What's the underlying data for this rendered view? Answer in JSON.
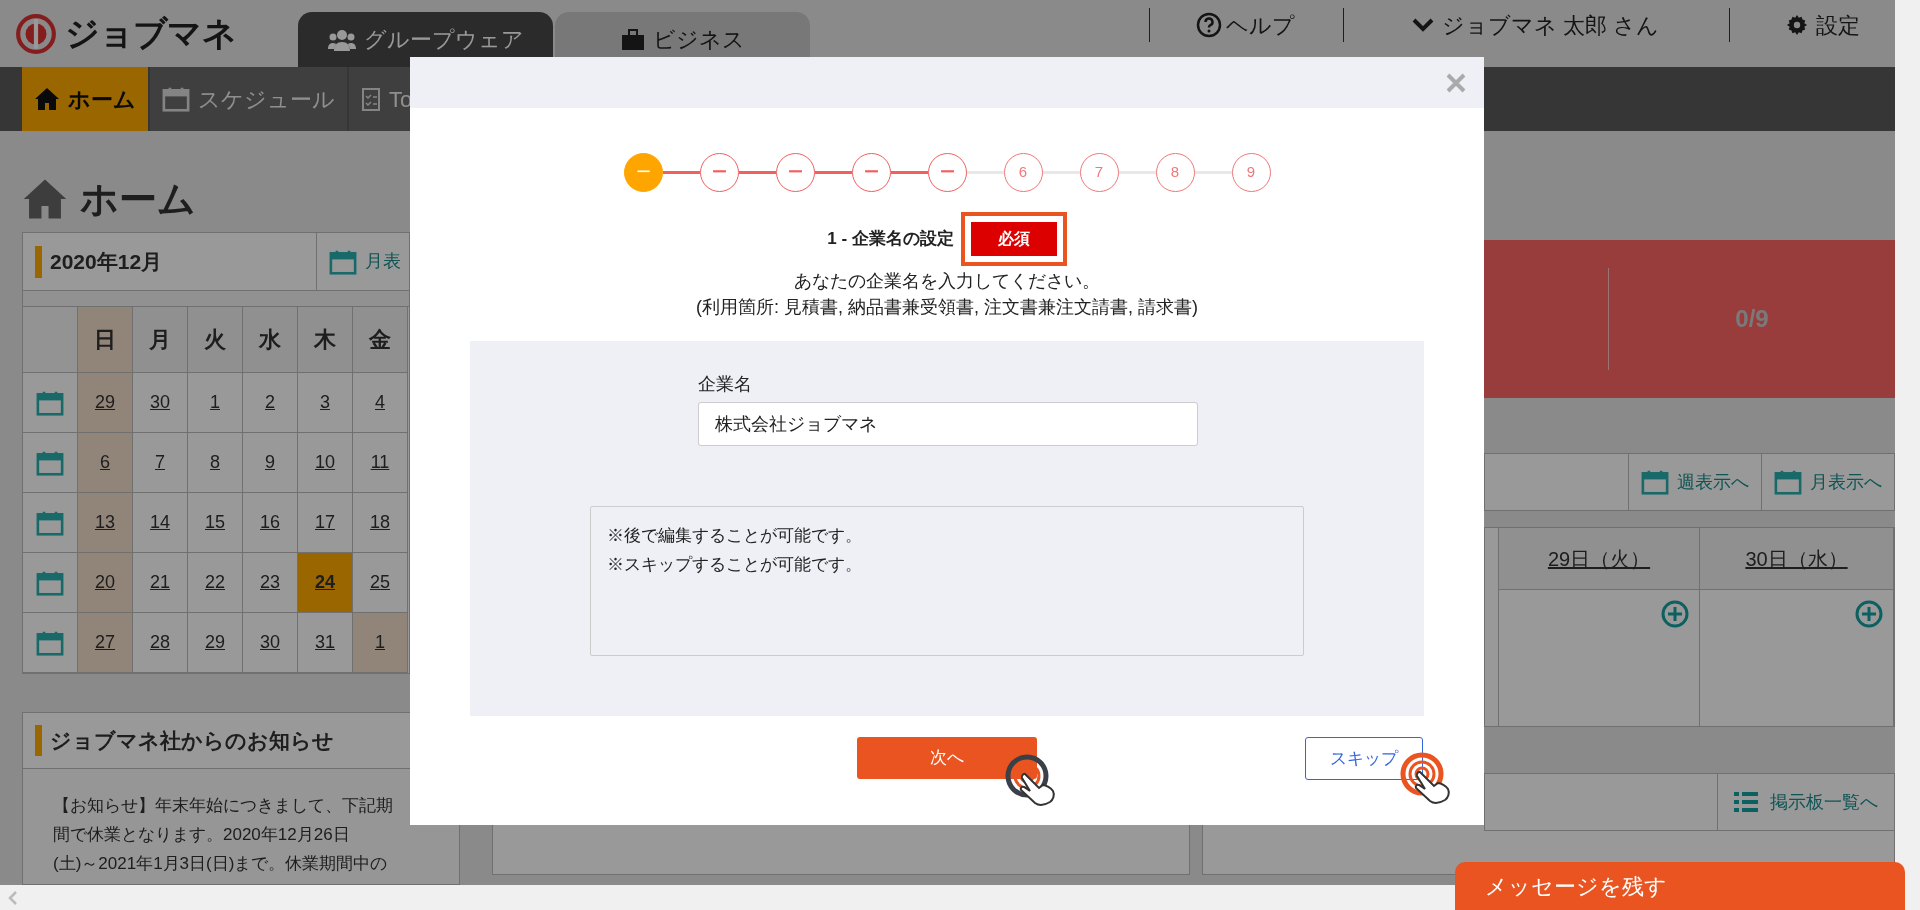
{
  "header": {
    "logo": "ジョブマネ",
    "tabs": [
      {
        "label": "グループウェア",
        "selected": true
      },
      {
        "label": "ビジネス",
        "selected": false
      }
    ],
    "help": "ヘルプ",
    "user": "ジョブマネ 太郎 さん",
    "settings": "設定"
  },
  "nav": [
    {
      "label": "ホーム",
      "selected": true
    },
    {
      "label": "スケジュール",
      "selected": false
    },
    {
      "label": "To",
      "selected": false
    }
  ],
  "page_title": "ホーム",
  "calendar": {
    "month": "2020年12月",
    "month_link": "月表",
    "weekdays": [
      {
        "label": "日",
        "kind": "holiday"
      },
      {
        "label": "月",
        "kind": "normal"
      },
      {
        "label": "火",
        "kind": "normal"
      },
      {
        "label": "水",
        "kind": "normal"
      },
      {
        "label": "木",
        "kind": "normal"
      },
      {
        "label": "金",
        "kind": "normal"
      }
    ],
    "weeks": [
      [
        {
          "day": "29",
          "kind": "holiday"
        },
        {
          "day": "30",
          "kind": "normal"
        },
        {
          "day": "1",
          "kind": "normal"
        },
        {
          "day": "2",
          "kind": "normal"
        },
        {
          "day": "3",
          "kind": "normal"
        },
        {
          "day": "4",
          "kind": "normal"
        }
      ],
      [
        {
          "day": "6",
          "kind": "holiday"
        },
        {
          "day": "7",
          "kind": "normal"
        },
        {
          "day": "8",
          "kind": "normal"
        },
        {
          "day": "9",
          "kind": "normal"
        },
        {
          "day": "10",
          "kind": "normal"
        },
        {
          "day": "11",
          "kind": "normal"
        }
      ],
      [
        {
          "day": "13",
          "kind": "holiday"
        },
        {
          "day": "14",
          "kind": "normal"
        },
        {
          "day": "15",
          "kind": "normal"
        },
        {
          "day": "16",
          "kind": "normal"
        },
        {
          "day": "17",
          "kind": "normal"
        },
        {
          "day": "18",
          "kind": "normal"
        }
      ],
      [
        {
          "day": "20",
          "kind": "holiday"
        },
        {
          "day": "21",
          "kind": "normal"
        },
        {
          "day": "22",
          "kind": "normal"
        },
        {
          "day": "23",
          "kind": "normal"
        },
        {
          "day": "24",
          "kind": "today"
        },
        {
          "day": "25",
          "kind": "normal"
        }
      ],
      [
        {
          "day": "27",
          "kind": "holiday"
        },
        {
          "day": "28",
          "kind": "normal"
        },
        {
          "day": "29",
          "kind": "normal"
        },
        {
          "day": "30",
          "kind": "normal"
        },
        {
          "day": "31",
          "kind": "normal"
        },
        {
          "day": "1",
          "kind": "holiday"
        }
      ]
    ]
  },
  "notice": {
    "title": "ジョブマネ社からのお知らせ",
    "lines": [
      "【お知らせ】年末年始につきまして、下記期",
      "間で休業となります。2020年12月26日",
      "(土)～2021年1月3日(日)まで。休業期間中の"
    ]
  },
  "progress_panel": {
    "value": "0/9"
  },
  "schedule": {
    "links": [
      "週表示へ",
      "月表示へ"
    ],
    "days": [
      "29日（火）",
      "30日（水）"
    ]
  },
  "board": {
    "link": "掲示板一覧へ"
  },
  "chat_button": "メッセージを残す",
  "modal": {
    "steps": [
      {
        "label": "ー",
        "done": true,
        "selected": true
      },
      {
        "label": "ー",
        "done": true,
        "selected": false
      },
      {
        "label": "ー",
        "done": true,
        "selected": false
      },
      {
        "label": "ー",
        "done": true,
        "selected": false
      },
      {
        "label": "ー",
        "done": true,
        "selected": false
      },
      {
        "label": "6",
        "done": false,
        "selected": false
      },
      {
        "label": "7",
        "done": false,
        "selected": false
      },
      {
        "label": "8",
        "done": false,
        "selected": false
      },
      {
        "label": "9",
        "done": false,
        "selected": false
      }
    ],
    "title": "1 - 企業名の設定",
    "badge": "必須",
    "description": [
      "あなたの企業名を入力してください。",
      "(利用箇所: 見積書, 納品書兼受領書, 注文書兼注文請書, 請求書)"
    ],
    "field_label": "企業名",
    "field_value": "株式会社ジョブマネ",
    "notes": [
      "※後で編集することが可能です。",
      "※スキップすることが可能です。"
    ],
    "next_button": "次へ",
    "skip_button": "スキップ"
  }
}
